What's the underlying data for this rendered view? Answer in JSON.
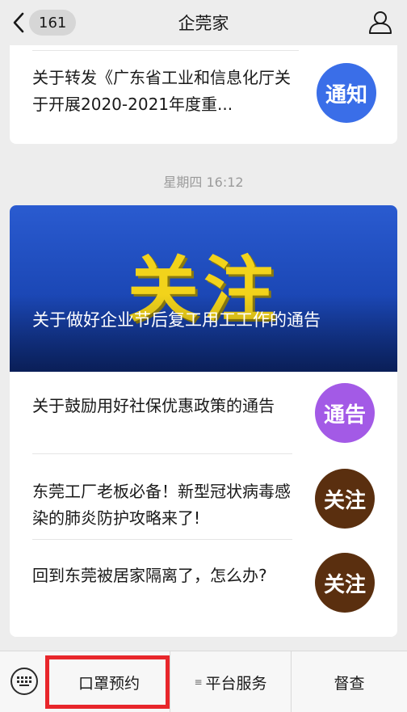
{
  "header": {
    "title": "企莞家",
    "unread_count": "161"
  },
  "top_card": {
    "text": "关于转发《广东省工业和信息化厅关于开展2020-2021年度重...",
    "tag": "通知",
    "tag_color": "#3a6ee8"
  },
  "timestamp": "星期四 16:12",
  "main_card": {
    "banner_big_text": "关注",
    "banner_headline": "关于做好企业节后复工用工工作的通告",
    "items": [
      {
        "text": "关于鼓励用好社保优惠政策的通告",
        "tag": "通告",
        "tag_color": "#a35ae6"
      },
      {
        "text": "东莞工厂老板必备！新型冠状病毒感染的肺炎防护攻略来了!",
        "tag": "关注",
        "tag_color": "#5a2f0f"
      },
      {
        "text": "回到东莞被居家隔离了，怎么办?",
        "tag": "关注",
        "tag_color": "#5a2f0f"
      }
    ]
  },
  "bottom_menu": {
    "items": [
      "口罩预约",
      "平台服务",
      "督查"
    ],
    "highlight_color": "#e8262b"
  }
}
